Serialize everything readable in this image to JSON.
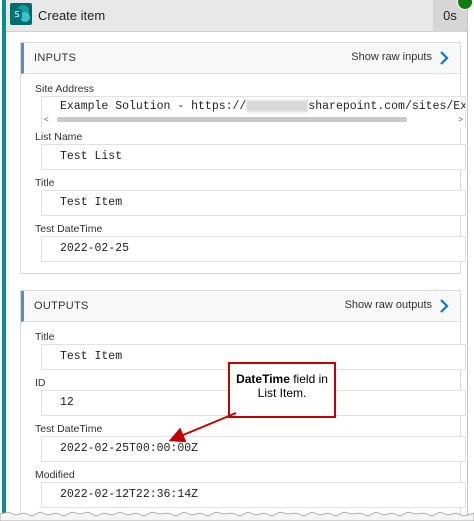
{
  "header": {
    "title": "Create item",
    "duration": "0s"
  },
  "inputs": {
    "section_title": "INPUTS",
    "raw_link": "Show raw inputs",
    "fields": [
      {
        "label": "Site Address",
        "value_prefix": "Example Solution - https://",
        "value_suffix": "sharepoint.com/sites/ExampleS"
      },
      {
        "label": "List Name",
        "value": "Test List"
      },
      {
        "label": "Title",
        "value": "Test Item"
      },
      {
        "label": "Test DateTime",
        "value": "2022-02-25"
      }
    ]
  },
  "outputs": {
    "section_title": "OUTPUTS",
    "raw_link": "Show raw outputs",
    "fields": [
      {
        "label": "Title",
        "value": "Test Item"
      },
      {
        "label": "ID",
        "value": "12"
      },
      {
        "label": "Test DateTime",
        "value": "2022-02-25T00:00:00Z"
      },
      {
        "label": "Modified",
        "value": "2022-02-12T22:36:14Z"
      }
    ]
  },
  "callout": {
    "bold": "DateTime",
    "rest1": " field in",
    "rest2": "List Item."
  },
  "colors": {
    "accent": "#0a8f86",
    "link_chevron": "#0078d4",
    "callout_border": "#c00000"
  }
}
